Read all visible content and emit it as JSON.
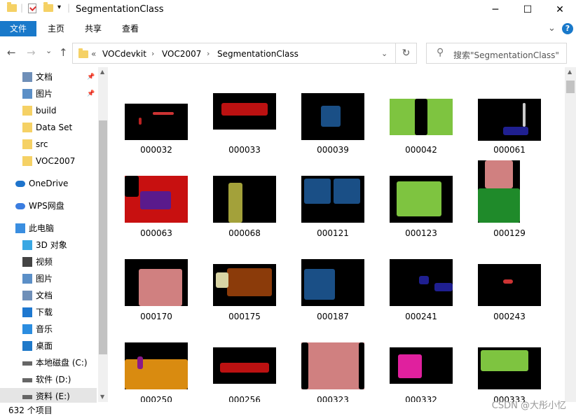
{
  "window": {
    "title": "SegmentationClass",
    "minimize": "─",
    "maximize": "☐",
    "close": "✕"
  },
  "ribbon": {
    "tabs": [
      "文件",
      "主页",
      "共享",
      "查看"
    ],
    "expand": "⌄",
    "help": "?"
  },
  "address": {
    "back": "←",
    "forward": "→",
    "history": "⌄",
    "up": "↑",
    "overflow": "«",
    "crumbs": [
      "VOCdevkit",
      "VOC2007",
      "SegmentationClass"
    ],
    "dropdown": "⌄",
    "refresh": "↻",
    "search_placeholder": "搜索\"SegmentationClass\""
  },
  "nav": {
    "items": [
      {
        "label": "文档",
        "icon": "documents-icon",
        "pinned": true
      },
      {
        "label": "图片",
        "icon": "pictures-icon",
        "pinned": true
      },
      {
        "label": "build",
        "icon": "folder-icon"
      },
      {
        "label": "Data Set",
        "icon": "folder-icon"
      },
      {
        "label": "src",
        "icon": "folder-icon"
      },
      {
        "label": "VOC2007",
        "icon": "folder-icon"
      },
      {
        "label": "OneDrive",
        "icon": "onedrive-icon"
      },
      {
        "label": "WPS网盘",
        "icon": "wps-cloud-icon"
      },
      {
        "label": "此电脑",
        "icon": "this-pc-icon"
      },
      {
        "label": "3D 对象",
        "icon": "3d-objects-icon"
      },
      {
        "label": "视频",
        "icon": "videos-icon"
      },
      {
        "label": "图片",
        "icon": "pictures-icon"
      },
      {
        "label": "文档",
        "icon": "documents-icon"
      },
      {
        "label": "下载",
        "icon": "downloads-icon"
      },
      {
        "label": "音乐",
        "icon": "music-icon"
      },
      {
        "label": "桌面",
        "icon": "desktop-icon"
      },
      {
        "label": "本地磁盘 (C:)",
        "icon": "drive-icon"
      },
      {
        "label": "软件 (D:)",
        "icon": "drive-icon"
      },
      {
        "label": "资料 (E:)",
        "icon": "drive-icon"
      }
    ]
  },
  "files": [
    "000032",
    "000033",
    "000039",
    "000042",
    "000061",
    "000063",
    "000068",
    "000121",
    "000123",
    "000129",
    "000170",
    "000175",
    "000187",
    "000241",
    "000243",
    "000250",
    "000256",
    "000323",
    "000332",
    "000333"
  ],
  "status": {
    "count": "632 个项目"
  },
  "watermark": "CSDN @大彤小忆",
  "colors": {
    "accent": "#1979ca",
    "folder": "#f5d165"
  }
}
